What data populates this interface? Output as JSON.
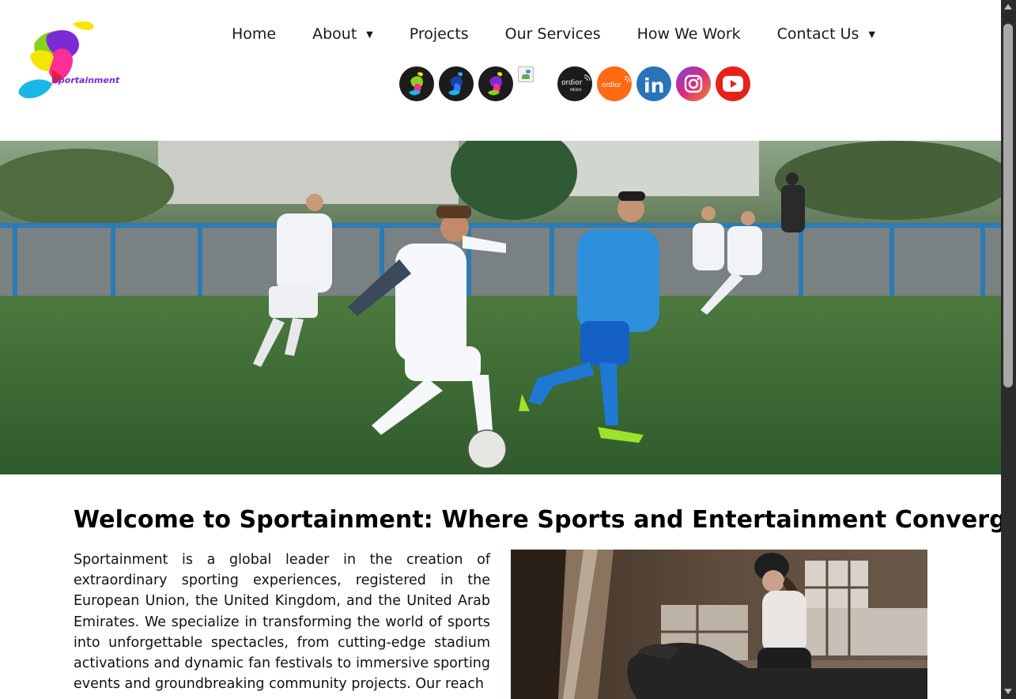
{
  "brand": {
    "name": "Sportainment"
  },
  "nav": {
    "items": [
      {
        "label": "Home"
      },
      {
        "label": "About",
        "has_dropdown": true
      },
      {
        "label": "Projects"
      },
      {
        "label": "Our Services"
      },
      {
        "label": "How We Work"
      },
      {
        "label": "Contact Us",
        "has_dropdown": true
      }
    ],
    "caret": "▼"
  },
  "socials": [
    {
      "name": "sportainment-logo-yellow-icon"
    },
    {
      "name": "sportainment-logo-blue-icon"
    },
    {
      "name": "sportainment-logo-pink-icon"
    },
    {
      "name": "broken-image-icon"
    },
    {
      "name": "ordior-media-icon",
      "text": "ordior",
      "subtext": "MEDIA"
    },
    {
      "name": "ordior-icon",
      "text": "ordior"
    },
    {
      "name": "linkedin-icon",
      "text": "in"
    },
    {
      "name": "instagram-icon"
    },
    {
      "name": "youtube-icon"
    }
  ],
  "colors": {
    "ordior_orange": "#ff6a13",
    "linkedin_blue": "#2a73b8",
    "youtube_red": "#e62117",
    "dark_circle": "#1c1c1c"
  },
  "main": {
    "heading": "Welcome to Sportainment: Where Sports and Entertainment Converge",
    "intro": "Sportainment is a global leader in the creation of extraordinary sporting experiences, registered in the European Union, the United Kingdom, and the United Arab Emirates. We specialize in transforming the world of sports into unforgettable spectacles, from cutting-edge stadium activations and dynamic fan festivals to immersive sporting events and groundbreaking community projects. Our reach"
  }
}
